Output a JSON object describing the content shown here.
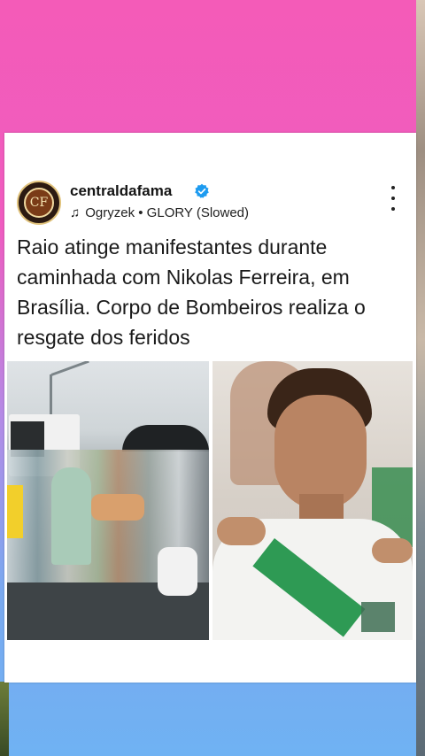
{
  "post": {
    "username": "centraldafama",
    "avatar_text": "CF",
    "music": "Ogryzek • GLORY (Slowed)",
    "headline": "Raio atinge manifestantes durante caminhada com Nikolas Ferreira, em Brasília. Corpo de Bombeiros realiza o resgate dos feridos"
  },
  "icons": {
    "verified": "verified-badge-icon",
    "music": "music-note-icon",
    "more": "more-vertical-icon"
  },
  "colors": {
    "verified_blue": "#1d9bf0",
    "bg_top": "#f45bb8",
    "bg_bottom": "#6fb2f3"
  }
}
